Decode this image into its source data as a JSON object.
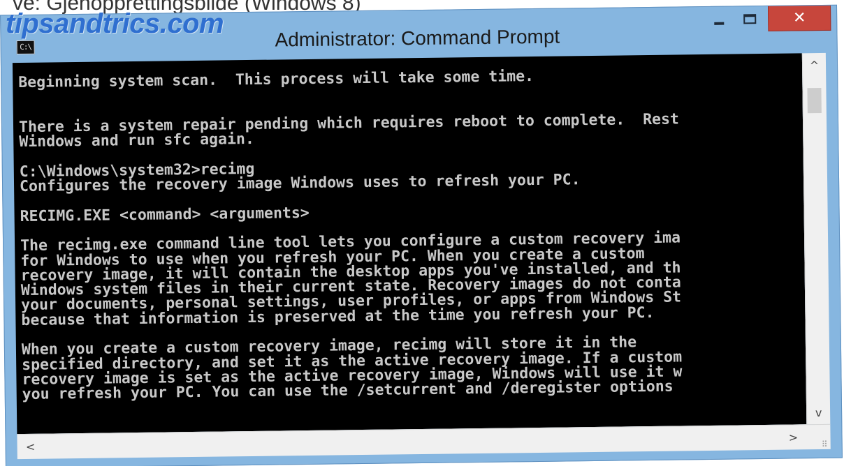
{
  "page_caption": "ve: Gjenopprettingsbilde (Windows 8)",
  "watermark": "tipsandtrics.com",
  "window": {
    "title": "Administrator: Command Prompt",
    "icon": "console-icon",
    "icon_text": "C:\\",
    "controls": {
      "minimize": "minimize-icon",
      "maximize": "maximize-icon",
      "close": "close-icon",
      "close_glyph": "✕"
    }
  },
  "console": {
    "lines": [
      "Beginning system scan.  This process will take some time.",
      "",
      "",
      "There is a system repair pending which requires reboot to complete.  Rest",
      "Windows and run sfc again.",
      "",
      "C:\\Windows\\system32>recimg",
      "Configures the recovery image Windows uses to refresh your PC.",
      "",
      "RECIMG.EXE <command> <arguments>",
      "",
      "The recimg.exe command line tool lets you configure a custom recovery ima",
      "for Windows to use when you refresh your PC. When you create a custom",
      "recovery image, it will contain the desktop apps you've installed, and th",
      "Windows system files in their current state. Recovery images do not conta",
      "your documents, personal settings, user profiles, or apps from Windows St",
      "because that information is preserved at the time you refresh your PC.",
      "",
      "When you create a custom recovery image, recimg will store it in the",
      "specified directory, and set it as the active recovery image. If a custom",
      "recovery image is set as the active recovery image, Windows will use it w",
      "you refresh your PC. You can use the /setcurrent and /deregister options"
    ]
  },
  "scrollbars": {
    "up_arrow": "^",
    "down_arrow": "v",
    "left_arrow": "<",
    "right_arrow": ">",
    "grip": "⠿"
  },
  "colors": {
    "console_bg": "#000000",
    "console_text": "#c8c8c8",
    "frame": "#86b6e0",
    "close_button": "#c7463c",
    "watermark": "#2f6fd0"
  }
}
